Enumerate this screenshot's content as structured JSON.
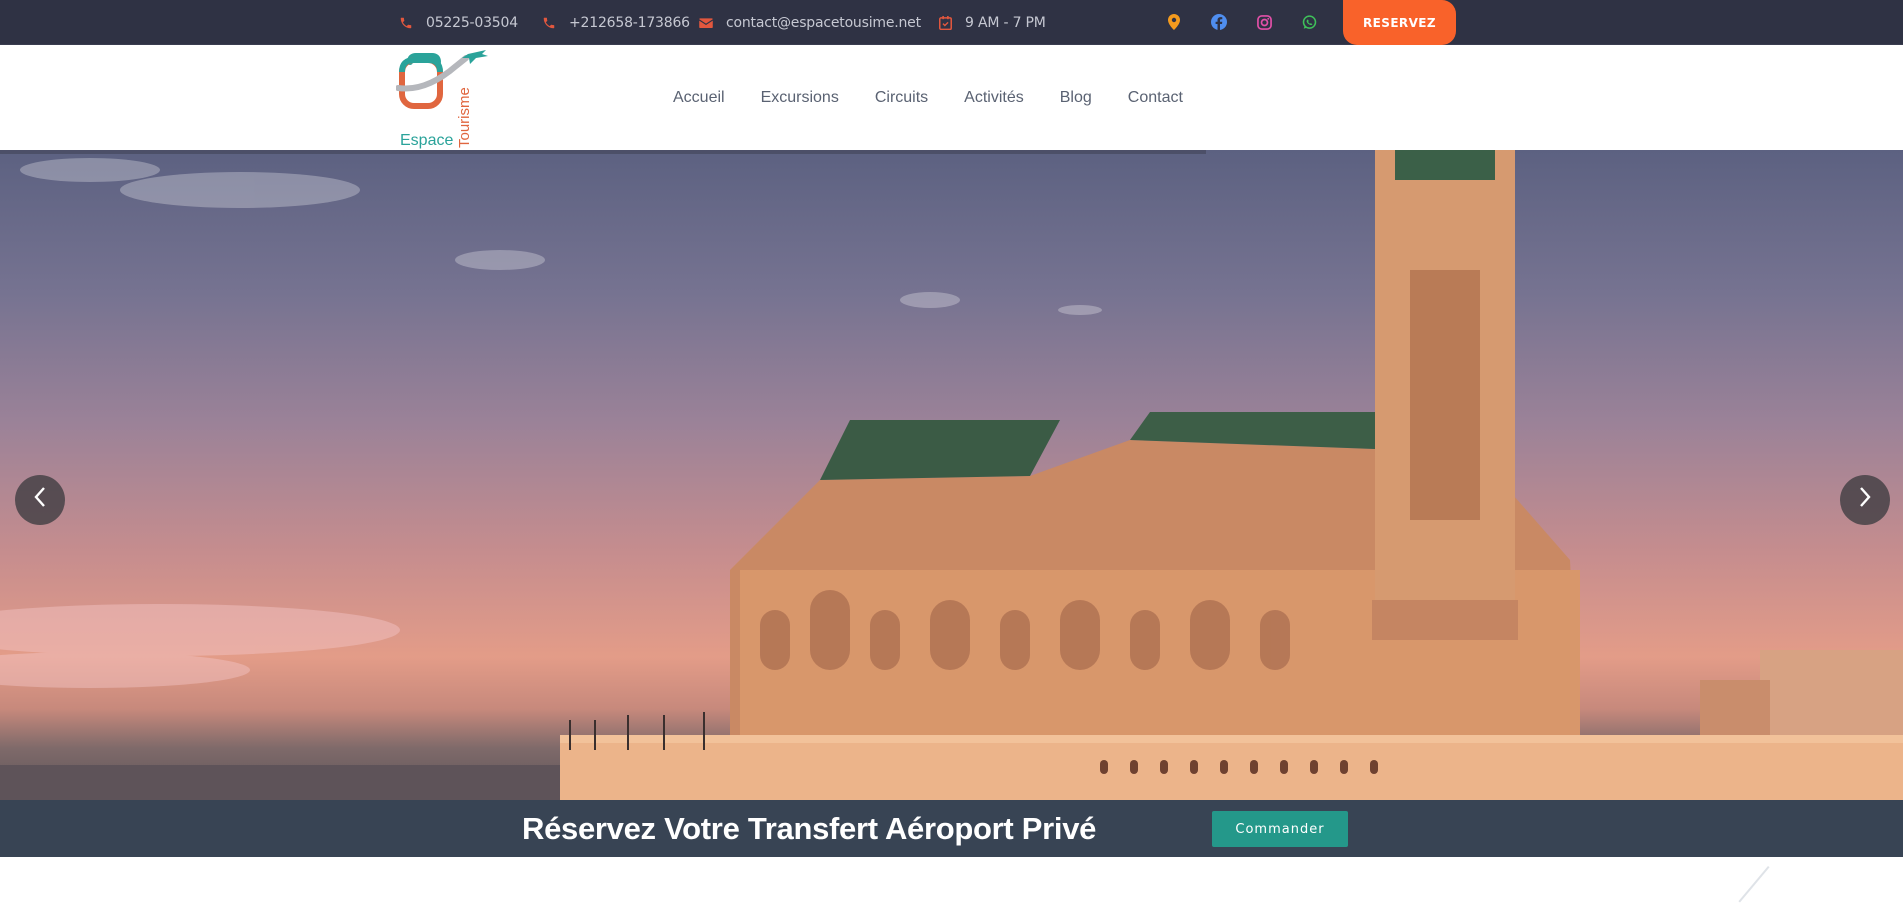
{
  "topbar": {
    "phone1": "05225-03504",
    "phone2": "+212658-173866",
    "email": "contact@espacetousime.net",
    "hours": "9 AM - 7 PM",
    "reserve_label": "RESERVEZ",
    "social": [
      "map-marker-icon",
      "facebook-icon",
      "instagram-icon",
      "whatsapp-icon"
    ],
    "icon_color": "#e2573e"
  },
  "logo": {
    "word1": "Espace",
    "word2": "Tourisme"
  },
  "nav": {
    "items": [
      "Accueil",
      "Excursions",
      "Circuits",
      "Activités",
      "Blog",
      "Contact"
    ]
  },
  "hero": {
    "prev_icon": "chevron-left-icon",
    "next_icon": "chevron-right-icon"
  },
  "cta": {
    "title": "Réservez Votre Transfert Aéroport Privé",
    "button_label": "Commander"
  },
  "colors": {
    "topbar_bg": "#2f3244",
    "accent_orange": "#f9622a",
    "cta_bg": "#384454",
    "teal": "#24988a"
  }
}
